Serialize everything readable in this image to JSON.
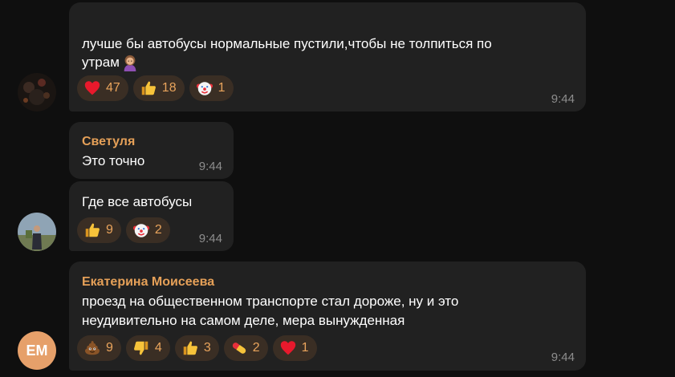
{
  "messages": [
    {
      "text_line1": "лучше бы автобусы нормальные пустили,чтобы не толпиться по",
      "text_line2": "утрам",
      "time": "9:44",
      "reactions": [
        {
          "icon": "heart-icon",
          "count": "47"
        },
        {
          "icon": "thumbs-up-icon",
          "count": "18"
        },
        {
          "icon": "clown-face-icon",
          "count": "1"
        }
      ]
    },
    {
      "author": "Светуля",
      "text": "Это точно",
      "time": "9:44"
    },
    {
      "text": "Где все автобусы",
      "time": "9:44",
      "reactions": [
        {
          "icon": "thumbs-up-icon",
          "count": "9"
        },
        {
          "icon": "clown-face-icon",
          "count": "2"
        }
      ]
    },
    {
      "author": "Екатерина Моисеева",
      "text_line1": "проезд на общественном транспорте стал дороже, ну и это",
      "text_line2": "неудивительно на самом деле, мера вынужденная",
      "time": "9:44",
      "avatar_initials": "ЕМ",
      "reactions": [
        {
          "icon": "pile-of-poo-icon",
          "count": "9"
        },
        {
          "icon": "thumbs-down-icon",
          "count": "4"
        },
        {
          "icon": "thumbs-up-icon",
          "count": "3"
        },
        {
          "icon": "pill-icon",
          "count": "2"
        },
        {
          "icon": "heart-icon",
          "count": "1"
        }
      ]
    }
  ],
  "colors": {
    "background": "#0f0f0f",
    "bubble": "#212121",
    "author": "#e5a058",
    "reaction_bg": "#3a2e24",
    "reaction_count": "#e9a45c",
    "time": "#8d8d8d"
  }
}
